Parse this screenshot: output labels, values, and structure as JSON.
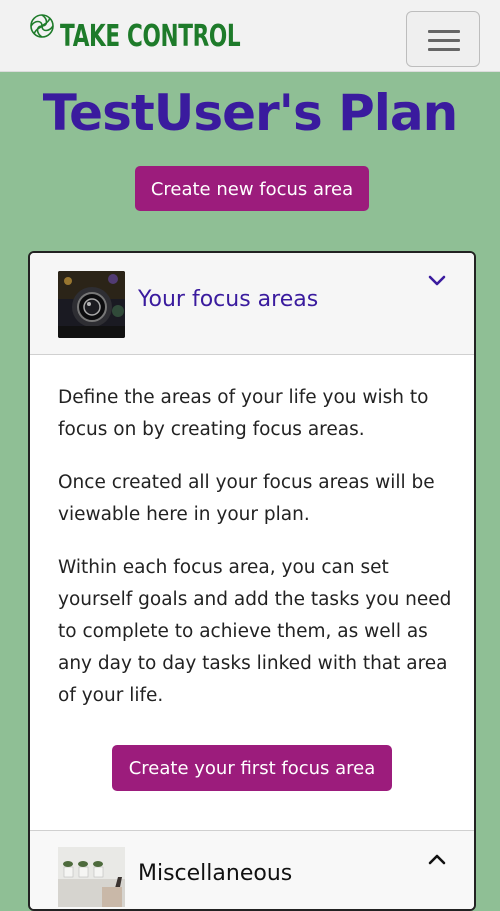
{
  "navbar": {
    "brand_text": "TAKE CONTROL",
    "brand_icon": "spiral-logo-icon",
    "toggler_icon": "hamburger-menu-icon"
  },
  "page": {
    "title": "TestUser's Plan",
    "create_button": "Create new focus area"
  },
  "accordion": {
    "section1": {
      "title": "Your focus areas",
      "thumbnail": "camera-lens-image",
      "chevron": "chevron-down-icon",
      "paragraphs": [
        "Define the areas of your life you wish to focus on by creating focus areas.",
        "Once created all your focus areas will be viewable here in your plan.",
        "Within each focus area, you can set yourself goals and add the tasks you need to complete to achieve them, as well as any day to day tasks linked with that area of your life."
      ],
      "button": "Create your first focus area"
    },
    "section2": {
      "title": "Miscellaneous",
      "thumbnail": "plants-image",
      "chevron": "chevron-up-icon"
    }
  },
  "colors": {
    "background": "#8fbf95",
    "brand_green": "#1e7b2a",
    "title_purple": "#3a1b9e",
    "button_magenta": "#9c1c7c"
  }
}
